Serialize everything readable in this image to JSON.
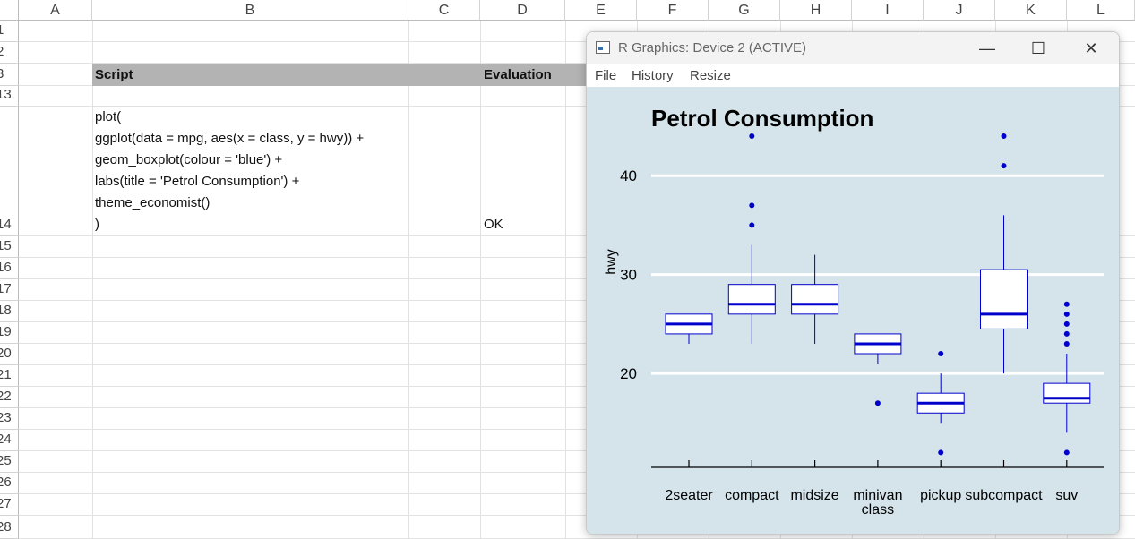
{
  "spreadsheet": {
    "columns": [
      "A",
      "B",
      "C",
      "D",
      "E",
      "F",
      "G",
      "H",
      "I",
      "J",
      "K",
      "L"
    ],
    "rows": [
      "1",
      "2",
      "3",
      "13",
      "14",
      "15",
      "16",
      "17",
      "18",
      "19",
      "20",
      "21",
      "22",
      "23",
      "24",
      "25",
      "26",
      "27",
      "28"
    ],
    "header_script": "Script",
    "header_evaluation": "Evaluation",
    "script_lines": [
      "plot(",
      "ggplot(data = mpg, aes(x = class, y = hwy)) +",
      "geom_boxplot(colour = 'blue') +",
      "labs(title = 'Petrol Consumption') +",
      "theme_economist()",
      ")"
    ],
    "evaluation_result": "OK"
  },
  "rwindow": {
    "title": "R Graphics: Device 2 (ACTIVE)",
    "menu": [
      "File",
      "History",
      "Resize"
    ],
    "minimize_glyph": "—",
    "maximize_glyph": "☐",
    "close_glyph": "✕"
  },
  "colors": {
    "plot_bg": "#d5e4eb",
    "box_color": "#0000cc",
    "gridline": "#ffffff",
    "header_fill": "#b3b3b3"
  },
  "chart_data": {
    "type": "boxplot",
    "title": "Petrol Consumption",
    "xlabel": "class",
    "ylabel": "hwy",
    "ylim": [
      10.5,
      45
    ],
    "yticks": [
      20,
      30,
      40
    ],
    "grid": "horizontal",
    "categories": [
      "2seater",
      "compact",
      "midsize",
      "minivan",
      "pickup",
      "subcompact",
      "suv"
    ],
    "boxes": [
      {
        "category": "2seater",
        "whisker_low": 23,
        "q1": 24,
        "median": 25,
        "q3": 26,
        "whisker_high": 26,
        "outliers": []
      },
      {
        "category": "compact",
        "whisker_low": 23,
        "q1": 26,
        "median": 27,
        "q3": 29,
        "whisker_high": 33,
        "outliers": [
          35,
          37,
          44
        ]
      },
      {
        "category": "midsize",
        "whisker_low": 23,
        "q1": 26,
        "median": 27,
        "q3": 29,
        "whisker_high": 32,
        "outliers": []
      },
      {
        "category": "minivan",
        "whisker_low": 21,
        "q1": 22,
        "median": 23,
        "q3": 24,
        "whisker_high": 24,
        "outliers": [
          17
        ]
      },
      {
        "category": "pickup",
        "whisker_low": 15,
        "q1": 16,
        "median": 17,
        "q3": 18,
        "whisker_high": 20,
        "outliers": [
          12,
          22
        ]
      },
      {
        "category": "subcompact",
        "whisker_low": 20,
        "q1": 24.5,
        "median": 26,
        "q3": 30.5,
        "whisker_high": 36,
        "outliers": [
          41,
          44
        ]
      },
      {
        "category": "suv",
        "whisker_low": 14,
        "q1": 17,
        "median": 17.5,
        "q3": 19,
        "whisker_high": 22,
        "outliers": [
          12,
          23,
          24,
          25,
          26,
          27
        ]
      }
    ]
  }
}
